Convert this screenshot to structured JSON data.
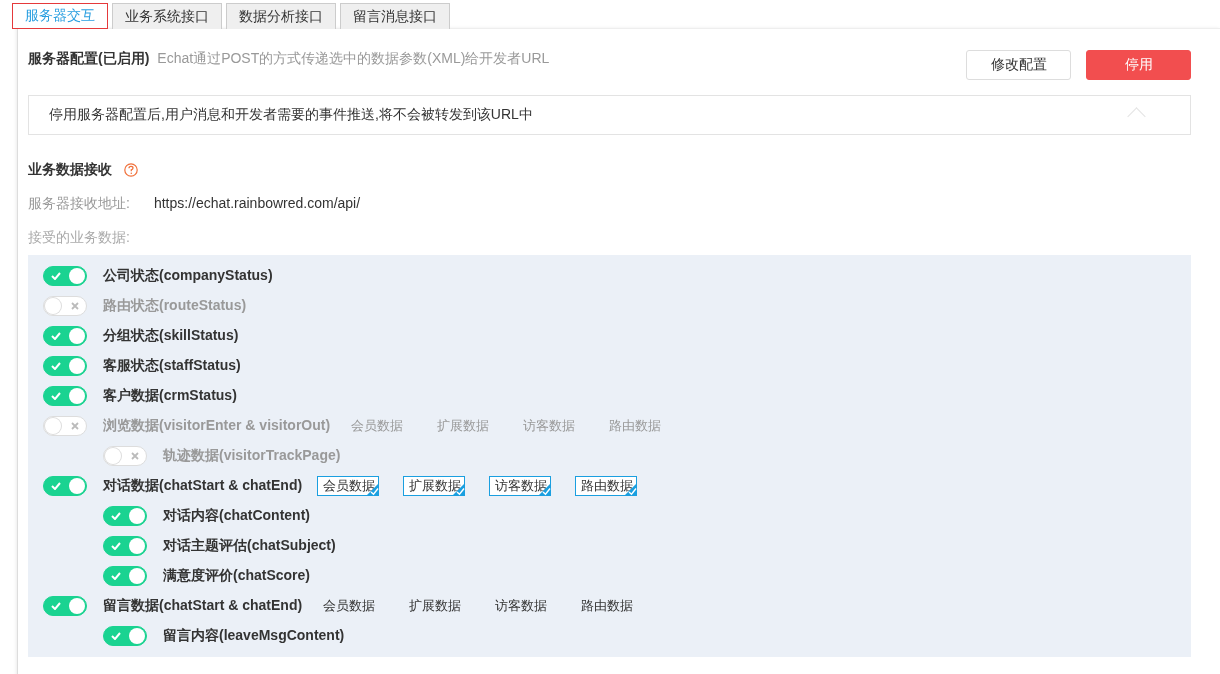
{
  "tabs": [
    {
      "label": "服务器交互",
      "selected": true
    },
    {
      "label": "业务系统接口",
      "selected": false
    },
    {
      "label": "数据分析接口",
      "selected": false
    },
    {
      "label": "留言消息接口",
      "selected": false
    }
  ],
  "server_config": {
    "title": "服务器配置(已启用)",
    "description": "Echat通过POST的方式传递选中的数据参数(XML)给开发者URL",
    "buttons": [
      {
        "label": "修改配置",
        "kind": "secondary"
      },
      {
        "label": "停用",
        "kind": "danger"
      }
    ],
    "notice": "停用服务器配置后,用户消息和开发者需要的事件推送,将不会被转发到该URL中"
  },
  "business": {
    "title": "业务数据接收",
    "url_label": "服务器接收地址:",
    "url": "https://echat.rainbowred.com/api/",
    "data_label": "接受的业务数据:",
    "items": [
      {
        "label": "公司状态(companyStatus)",
        "on": true
      },
      {
        "label": "路由状态(routeStatus)",
        "on": false
      },
      {
        "label": "分组状态(skillStatus)",
        "on": true
      },
      {
        "label": "客服状态(staffStatus)",
        "on": true
      },
      {
        "label": "客户数据(crmStatus)",
        "on": true
      },
      {
        "label": "浏览数据(visitorEnter & visitorOut)",
        "on": false,
        "options": [
          {
            "label": "会员数据",
            "checked": false
          },
          {
            "label": "扩展数据",
            "checked": false
          },
          {
            "label": "访客数据",
            "checked": false
          },
          {
            "label": "路由数据",
            "checked": false
          }
        ],
        "children": [
          {
            "label": "轨迹数据(visitorTrackPage)",
            "on": false
          }
        ]
      },
      {
        "label": "对话数据(chatStart & chatEnd)",
        "on": true,
        "options": [
          {
            "label": "会员数据",
            "checked": true
          },
          {
            "label": "扩展数据",
            "checked": true
          },
          {
            "label": "访客数据",
            "checked": true
          },
          {
            "label": "路由数据",
            "checked": true
          }
        ],
        "children": [
          {
            "label": "对话内容(chatContent)",
            "on": true
          },
          {
            "label": "对话主题评估(chatSubject)",
            "on": true
          },
          {
            "label": "满意度评价(chatScore)",
            "on": true
          }
        ]
      },
      {
        "label": "留言数据(chatStart & chatEnd)",
        "on": true,
        "options": [
          {
            "label": "会员数据",
            "checked": false
          },
          {
            "label": "扩展数据",
            "checked": false
          },
          {
            "label": "访客数据",
            "checked": false
          },
          {
            "label": "路由数据",
            "checked": false
          }
        ],
        "children": [
          {
            "label": "留言内容(leaveMsgContent)",
            "on": true
          }
        ]
      }
    ]
  }
}
